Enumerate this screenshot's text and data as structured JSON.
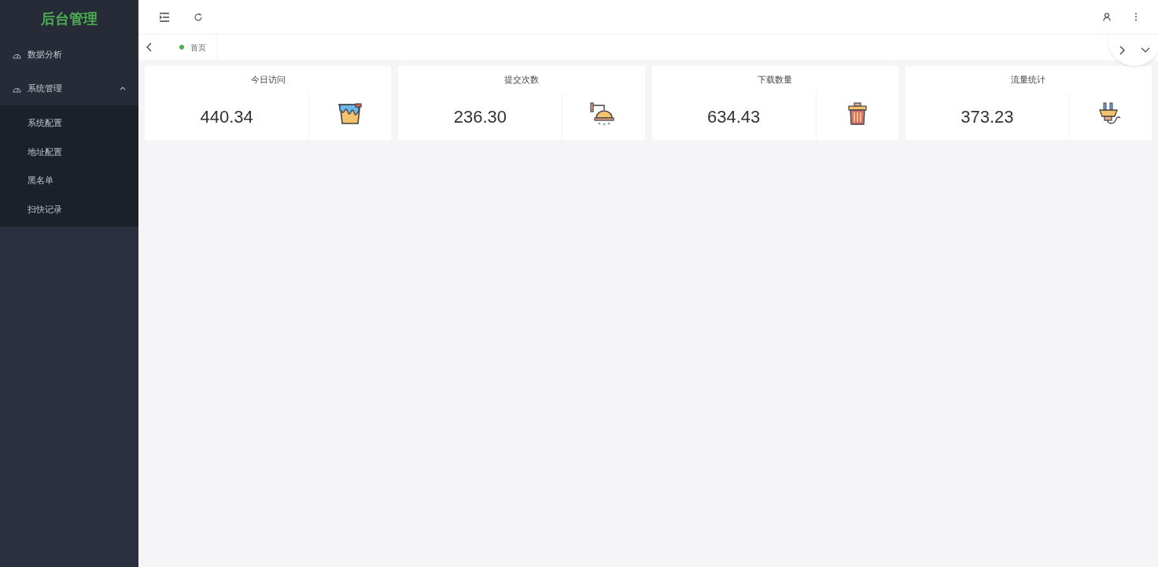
{
  "sidebar": {
    "logo": "后台管理",
    "items": [
      {
        "label": "数据分析"
      },
      {
        "label": "系统管理",
        "expanded": true,
        "children": [
          {
            "label": "系统配置"
          },
          {
            "label": "地址配置"
          },
          {
            "label": "黑名单"
          },
          {
            "label": "扫快记录"
          }
        ]
      }
    ]
  },
  "tabs": [
    {
      "label": "首页",
      "selected": true
    }
  ],
  "cards": [
    {
      "title": "今日访问",
      "value": "440.34"
    },
    {
      "title": "提交次数",
      "value": "236.30"
    },
    {
      "title": "下载数量",
      "value": "634.43"
    },
    {
      "title": "流量统计",
      "value": "373.23"
    }
  ]
}
